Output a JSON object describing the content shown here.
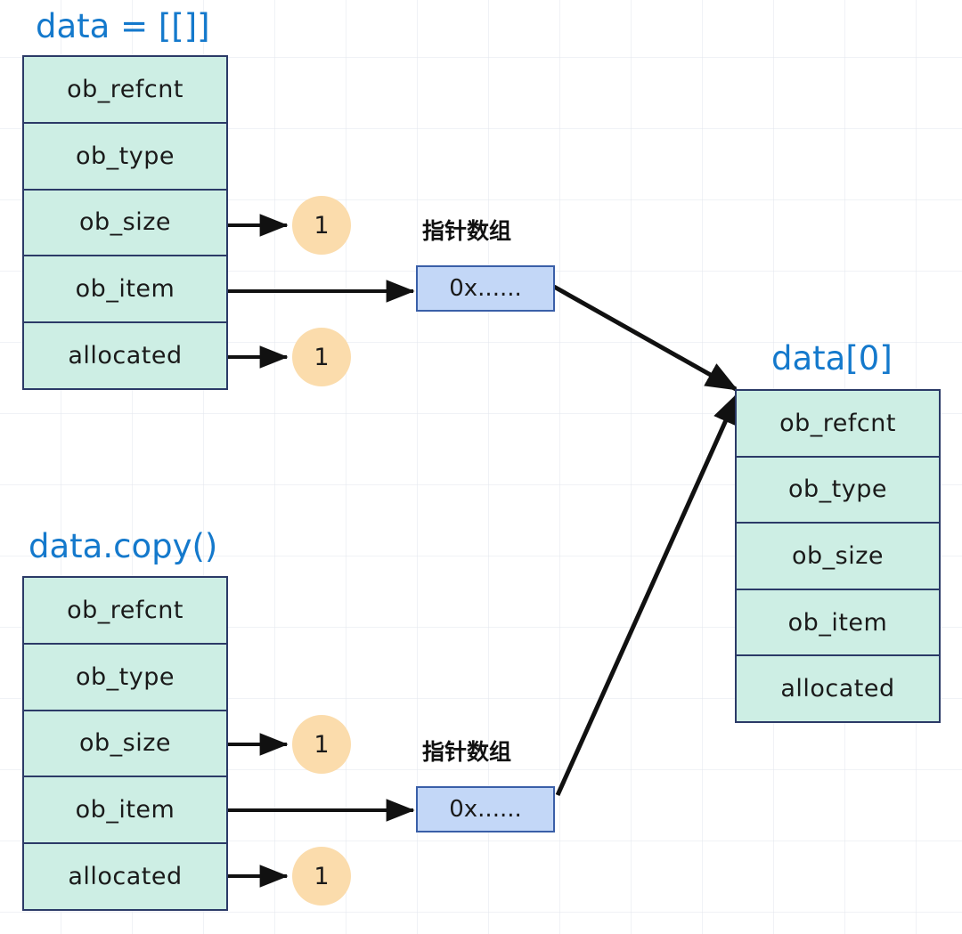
{
  "diagram": {
    "title_color": "#1479cc",
    "struct_fill": "#cdeee4",
    "struct_border": "#2b3a67",
    "pointer_fill": "#c3d7f7",
    "pointer_border": "#3a5fa8",
    "circle_fill": "#fbdcac",
    "arrow_color": "#111111"
  },
  "structs": {
    "data_list": {
      "title": "data = [[]]",
      "fields": [
        "ob_refcnt",
        "ob_type",
        "ob_size",
        "ob_item",
        "allocated"
      ]
    },
    "data_copy": {
      "title": "data.copy()",
      "fields": [
        "ob_refcnt",
        "ob_type",
        "ob_size",
        "ob_item",
        "allocated"
      ]
    },
    "data_zero": {
      "title": "data[0]",
      "fields": [
        "ob_refcnt",
        "ob_type",
        "ob_size",
        "ob_item",
        "allocated"
      ]
    }
  },
  "pointer_arrays": {
    "top": {
      "label": "指针数组",
      "value": "0x......"
    },
    "bottom": {
      "label": "指针数组",
      "value": "0x......"
    }
  },
  "counts": {
    "top_ob_size": "1",
    "top_allocated": "1",
    "bottom_ob_size": "1",
    "bottom_allocated": "1"
  }
}
